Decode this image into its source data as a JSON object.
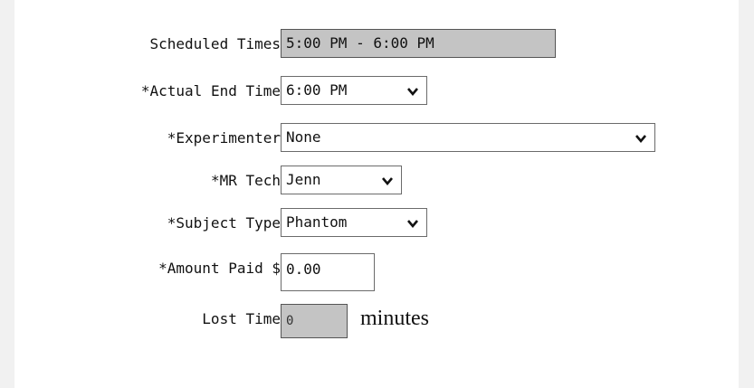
{
  "form": {
    "scheduled_times": {
      "label": "Scheduled Times",
      "value": "5:00 PM - 6:00 PM"
    },
    "actual_end_time": {
      "label": "*Actual End Time",
      "value": "6:00 PM"
    },
    "experimenter": {
      "label": "*Experimenter",
      "value": "None"
    },
    "mr_tech": {
      "label": "*MR Tech",
      "value": "Jenn"
    },
    "subject_type": {
      "label": "*Subject Type",
      "value": "Phantom"
    },
    "amount_paid": {
      "label": "*Amount Paid $",
      "value": "0.00"
    },
    "lost_time": {
      "label": "Lost Time",
      "value": "0",
      "unit": "minutes"
    }
  },
  "icons": {
    "dropdown": "chevron-down-icon"
  }
}
